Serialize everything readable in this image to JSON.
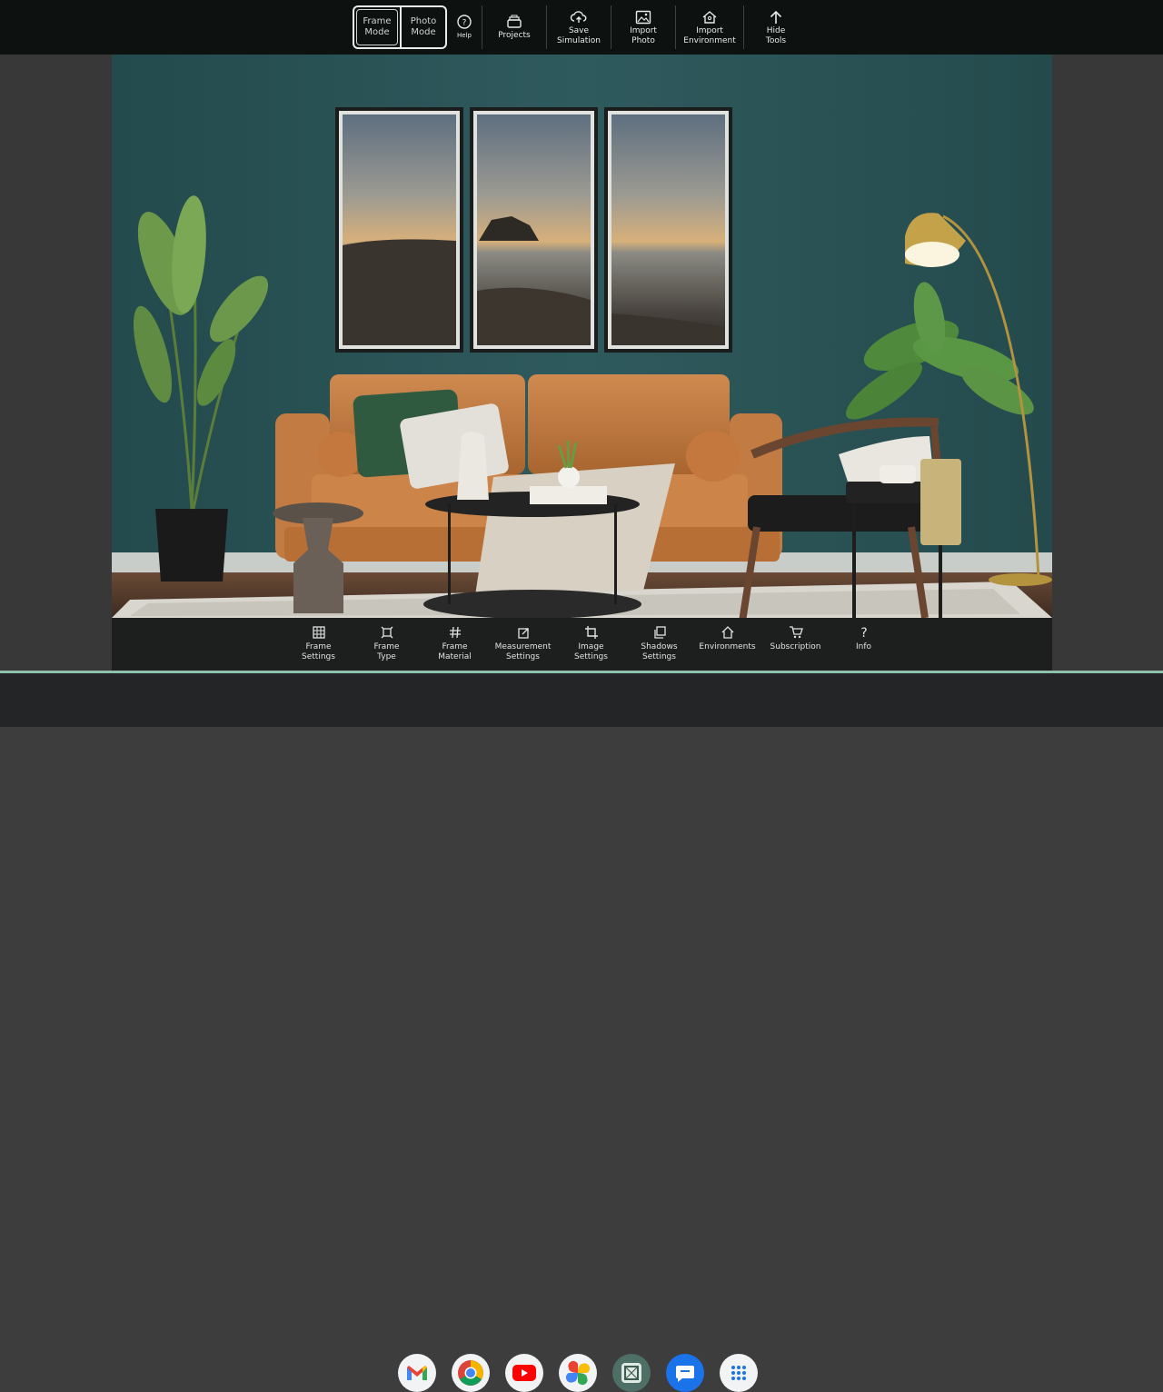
{
  "toolbar": {
    "frame_mode": "Frame\nMode",
    "photo_mode": "Photo\nMode",
    "help": "Help",
    "projects": "Projects",
    "save_simulation": "Save\nSimulation",
    "import_photo": "Import\nPhoto",
    "import_environment": "Import\nEnvironment",
    "hide_tools": "Hide\nTools",
    "active_mode": "frame"
  },
  "bottom_toolbar": {
    "items": [
      {
        "label": "Frame\nSettings",
        "icon": "grid-icon"
      },
      {
        "label": "Frame\nType",
        "icon": "frame-type-icon"
      },
      {
        "label": "Frame\nMaterial",
        "icon": "hash-icon"
      },
      {
        "label": "Measurement\nSettings",
        "icon": "measure-icon"
      },
      {
        "label": "Image\nSettings",
        "icon": "crop-icon"
      },
      {
        "label": "Shadows\nSettings",
        "icon": "shadow-icon"
      },
      {
        "label": "Environments",
        "icon": "home-icon"
      },
      {
        "label": "Subscription",
        "icon": "cart-icon"
      },
      {
        "label": "Info",
        "icon": "question-icon"
      }
    ]
  },
  "shelf": {
    "apps": [
      {
        "name": "Gmail",
        "icon": "gmail-icon"
      },
      {
        "name": "Chrome",
        "icon": "chrome-icon"
      },
      {
        "name": "YouTube",
        "icon": "youtube-icon"
      },
      {
        "name": "Google Photos",
        "icon": "photos-icon"
      },
      {
        "name": "Frame app",
        "icon": "frame-app-icon"
      },
      {
        "name": "Messages",
        "icon": "messages-icon"
      },
      {
        "name": "App launcher",
        "icon": "launcher-icon"
      }
    ]
  },
  "colors": {
    "wall": "#2c5558",
    "sofa": "#c9834a",
    "accent": "#8fc2ad",
    "toolbar_bg": "#0d1110"
  }
}
